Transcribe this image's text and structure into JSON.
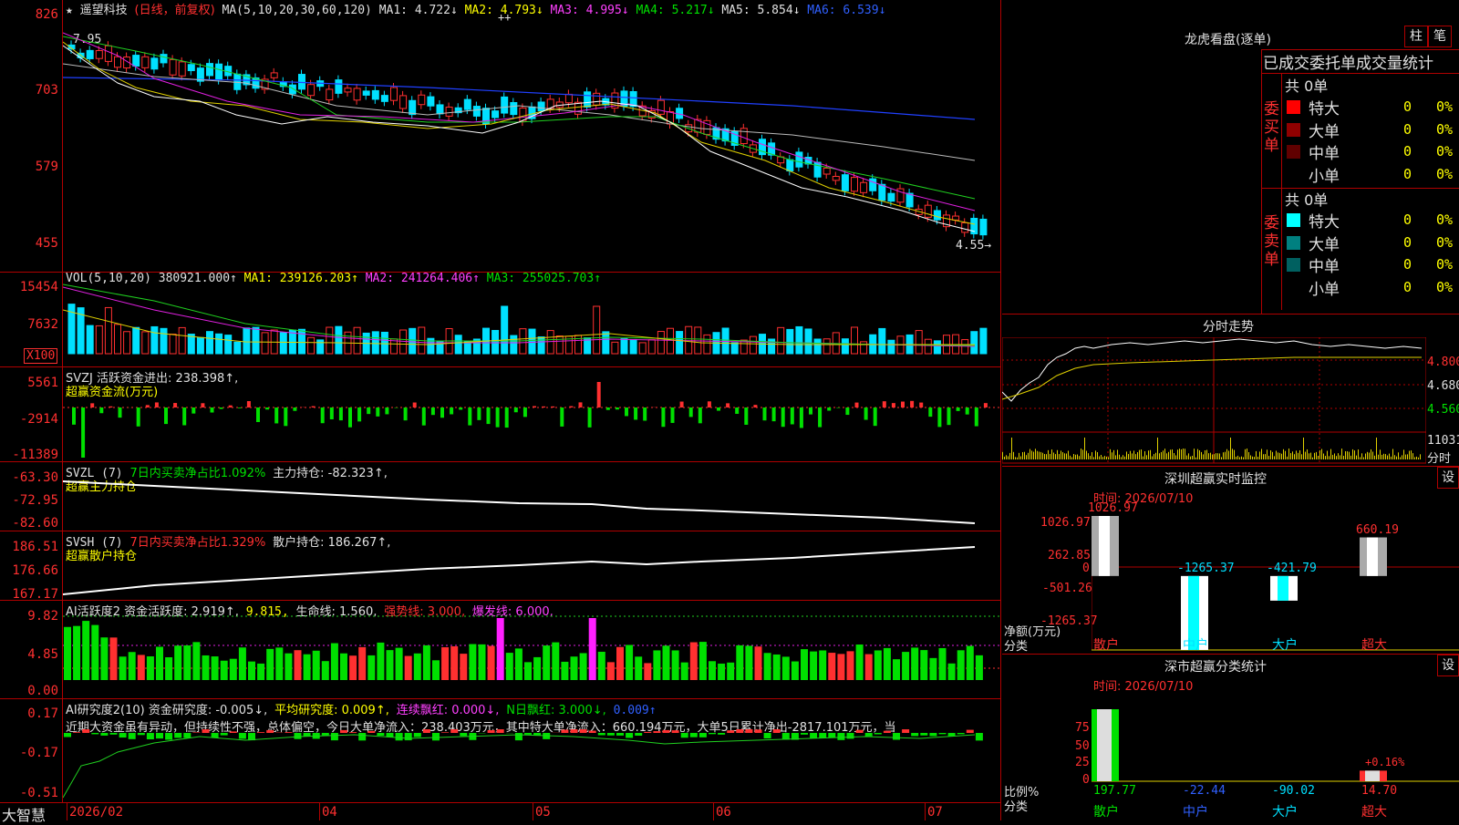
{
  "header": {
    "star": "★",
    "stock_name": "遥望科技",
    "period": "(日线，前复权)",
    "ma_label": "MA(5,10,20,30,60,120)",
    "ma1": "MA1: 4.722↓",
    "ma2": "MA2: 4.793↓",
    "ma3": "MA3: 4.995↓",
    "ma4": "MA4: 5.217↓",
    "ma5": "MA5: 5.854↓",
    "ma6": "MA6: 6.539↓",
    "plus_marks": "++"
  },
  "price_axis": [
    "826",
    "703",
    "579",
    "455"
  ],
  "price_annotations": {
    "high": "7.95",
    "low": "4.55→"
  },
  "vol": {
    "legend": "VOL(5,10,20)",
    "value": "380921.000↑",
    "ma1": "MA1: 239126.203↑",
    "ma2": "MA2: 241264.406↑",
    "ma3": "MA3: 255025.703↑",
    "axis": [
      "15454",
      "7632"
    ],
    "unit": "X100"
  },
  "svzj": {
    "legend1": "SVZJ  活跃资金进出: 238.398↑,",
    "legend2": "超赢资金流(万元)",
    "axis": [
      "5561",
      "-2914",
      "-11389"
    ]
  },
  "svzl": {
    "legend1a": "SVZL (7)",
    "legend1b": "7日内买卖净占比1.092%",
    "legend1c": "主力持仓: -82.323↑,",
    "legend2": "超赢主力持仓",
    "axis": [
      "-63.30",
      "-72.95",
      "-82.60"
    ]
  },
  "svsh": {
    "legend1a": "SVSH (7)",
    "legend1b": "7日内买卖净占比1.329%",
    "legend1c": "散户持仓: 186.267↑,",
    "legend2": "超赢散户持仓",
    "axis": [
      "186.51",
      "176.66",
      "167.17"
    ]
  },
  "ai_active": {
    "legend_a": "AI活跃度2 资金活跃度: 2.919↑,",
    "legend_b": "9.815,",
    "legend_c": "生命线: 1.560,",
    "legend_d": "强势线: 3.000,",
    "legend_e": "爆发线: 6.000,",
    "axis": [
      "9.82",
      "4.85",
      "0.00"
    ]
  },
  "ai_research": {
    "legend_a": "AI研究度2(10) 资金研究度: -0.005↓,",
    "legend_b": "平均研究度: 0.009↑,",
    "legend_c": "连续飘红: 0.000↓,",
    "legend_d": "N日飘红: 3.000↓,",
    "legend_e": "0.009↑",
    "comment": "近期大资金虽有异动，但持续性不强，总体偏空，今日大单净流入：238.403万元，其中特大单净流入：660.194万元，大单5日累计净出-2817.101万元，当",
    "axis": [
      "0.17",
      "-0.17",
      "-0.51"
    ]
  },
  "xaxis": [
    "2026/02",
    "04",
    "05",
    "06",
    "07"
  ],
  "brand": "大智慧",
  "right": {
    "dragon_title": "龙虎看盘(逐单)",
    "btn_zhu": "柱",
    "btn_bi": "笔",
    "tabs_header": "已成交委托单成交量统计",
    "buy_label": "委买单",
    "sell_label": "委卖单",
    "buy_total": "共 0单",
    "sell_total": "共 0单",
    "buy_rows": [
      {
        "label": "特大",
        "value": "0",
        "pct": "0%",
        "color": "#ff0000"
      },
      {
        "label": "大单",
        "value": "0",
        "pct": "0%",
        "color": "#900000"
      },
      {
        "label": "中单",
        "value": "0",
        "pct": "0%",
        "color": "#600000"
      },
      {
        "label": "小单",
        "value": "0",
        "pct": "0%",
        "color": "#000000"
      }
    ],
    "sell_rows": [
      {
        "label": "特大",
        "value": "0",
        "pct": "0%",
        "color": "#00ffff"
      },
      {
        "label": "大单",
        "value": "0",
        "pct": "0%",
        "color": "#008080"
      },
      {
        "label": "中单",
        "value": "0",
        "pct": "0%",
        "color": "#006060"
      },
      {
        "label": "小单",
        "value": "0",
        "pct": "0%",
        "color": "#000000"
      }
    ],
    "intraday_title": "分时走势",
    "intraday_axis": [
      "4.800",
      "4.680",
      "4.560"
    ],
    "intraday_vol": "11031",
    "intraday_vol_label": "分时",
    "monitor_title": "深圳超赢实时监控",
    "monitor_btn": "设",
    "monitor_time": "时间: 2026/07/10",
    "monitor_axis": [
      "1026.97",
      "262.85",
      "0",
      "-501.26",
      "-1265.37"
    ],
    "monitor_ylabel": "净额(万元)",
    "monitor_xlabel": "分类",
    "monitor_values": [
      "1026.97",
      "-1265.37",
      "-421.79",
      "660.19"
    ],
    "monitor_cats": [
      "散户",
      "中户",
      "大户",
      "超大"
    ],
    "stats_title": "深市超赢分类统计",
    "stats_btn": "设",
    "stats_time": "时间: 2026/07/10",
    "stats_axis": [
      "75",
      "50",
      "25",
      "0"
    ],
    "stats_ylabel": "比例%",
    "stats_xlabel": "分类",
    "stats_values": [
      "197.77",
      "-22.44",
      "-90.02",
      "14.70"
    ],
    "stats_extra": "+0.16%",
    "stats_cats": [
      "散户",
      "中户",
      "大户",
      "超大"
    ]
  }
}
